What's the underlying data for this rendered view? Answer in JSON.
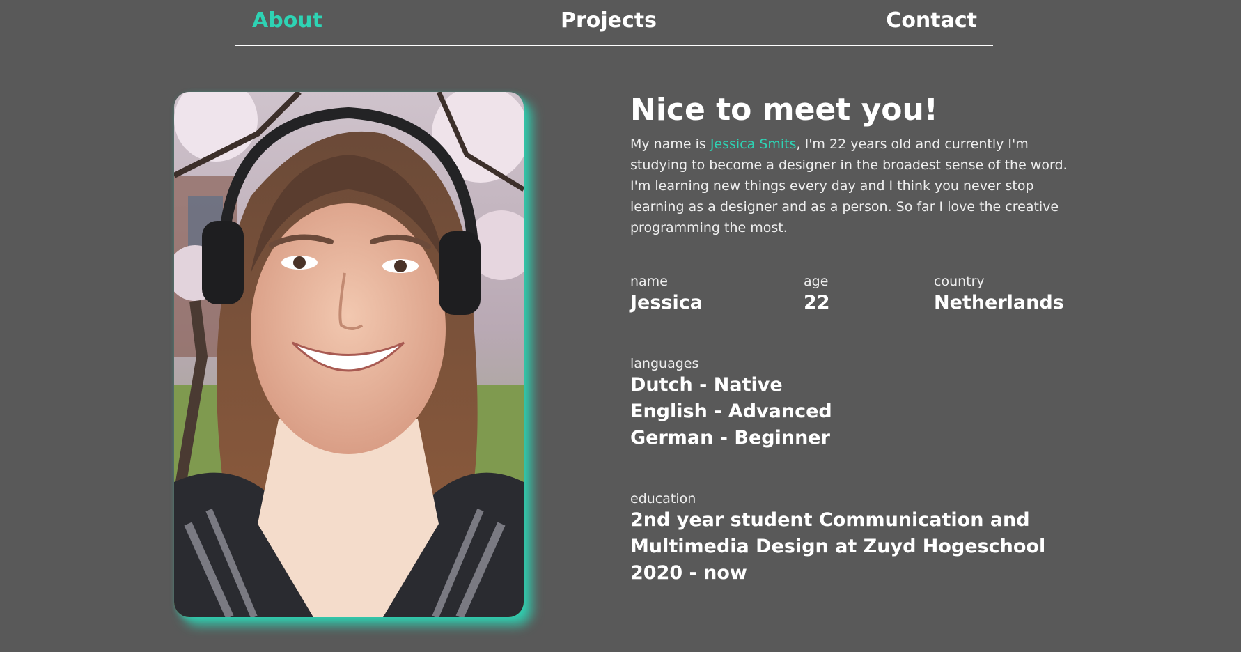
{
  "nav": {
    "about": "About",
    "projects": "Projects",
    "contact": "Contact"
  },
  "about": {
    "heading": "Nice to meet you!",
    "bio_before": "My name is ",
    "bio_name": "Jessica Smits",
    "bio_after": ", I'm 22 years old and currently I'm studying to become a designer in the broadest sense of the word. I'm learning new things every day and I think you never stop learning as a designer and as a person. So far I love the creative programming the most.",
    "name_label": "name",
    "name_value": "Jessica",
    "age_label": "age",
    "age_value": "22",
    "country_label": "country",
    "country_value": "Netherlands",
    "languages_label": "languages",
    "languages": [
      "Dutch - Native",
      "English - Advanced",
      "German - Beginner"
    ],
    "education_label": "education",
    "education_lines": [
      "2nd year student Communication and",
      "Multimedia Design at Zuyd Hogeschool",
      "2020 - now"
    ]
  },
  "colors": {
    "background": "#595959",
    "accent": "#2ed3b4",
    "text": "#ffffff"
  }
}
